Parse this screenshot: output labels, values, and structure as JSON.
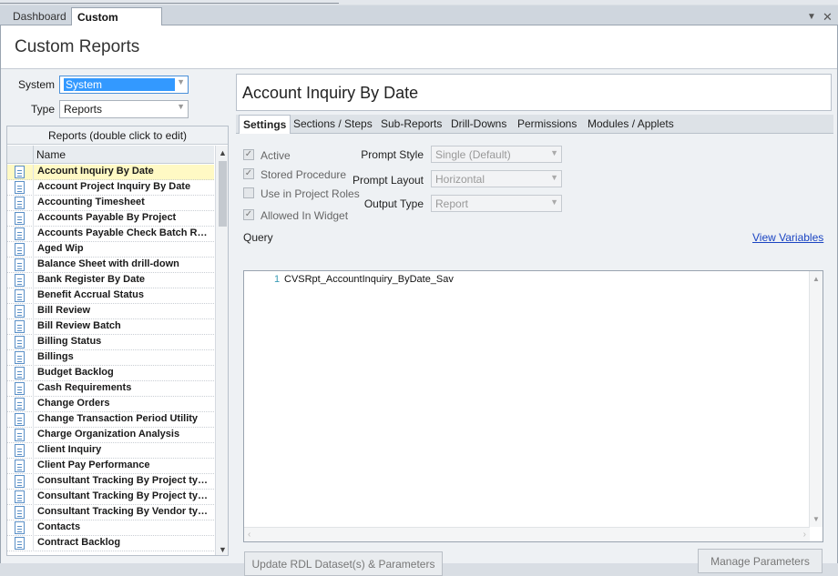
{
  "tabs": [
    "Dashboard",
    "Custom Reports"
  ],
  "page_title": "Custom Reports",
  "filters": {
    "system_label": "System",
    "system_value": "System",
    "type_label": "Type",
    "type_value": "Reports"
  },
  "grid": {
    "caption": "Reports (double click to edit)",
    "column_name": "Name",
    "rows": [
      "Account Inquiry By Date",
      "Account Project Inquiry By Date",
      "Accounting Timesheet",
      "Accounts Payable By Project",
      "Accounts Payable Check Batch Report",
      "Aged Wip",
      "Balance Sheet with drill-down",
      "Bank Register By Date",
      "Benefit Accrual Status",
      "Bill Review",
      "Bill Review Batch",
      "Billing Status",
      "Billings",
      "Budget Backlog",
      "Cash Requirements",
      "Change Orders",
      "Change Transaction Period Utility",
      "Charge Organization Analysis",
      "Client Inquiry",
      "Client Pay Performance",
      "Consultant Tracking By Project type",
      "Consultant Tracking By Project type",
      "Consultant Tracking By Vendor type",
      "Contacts",
      "Contract Backlog"
    ]
  },
  "report_title": "Account Inquiry By Date",
  "detail_tabs": [
    "Settings",
    "Sections / Steps",
    "Sub-Reports",
    "Drill-Downs",
    "Permissions",
    "Modules / Applets"
  ],
  "settings": {
    "active": "Active",
    "stored_procedure": "Stored Procedure",
    "use_in_project_roles": "Use in Project Roles",
    "allowed_in_widget": "Allowed In Widget",
    "prompt_style_label": "Prompt Style",
    "prompt_style_value": "Single (Default)",
    "prompt_layout_label": "Prompt Layout",
    "prompt_layout_value": "Horizontal",
    "output_type_label": "Output Type",
    "output_type_value": "Report",
    "query_label": "Query",
    "view_variables": "View Variables",
    "query_line_number": "1",
    "query_text": "CVSRpt_AccountInquiry_ByDate_Sav",
    "update_button": "Update RDL Dataset(s) & Parameters",
    "manage_button": "Manage Parameters"
  }
}
